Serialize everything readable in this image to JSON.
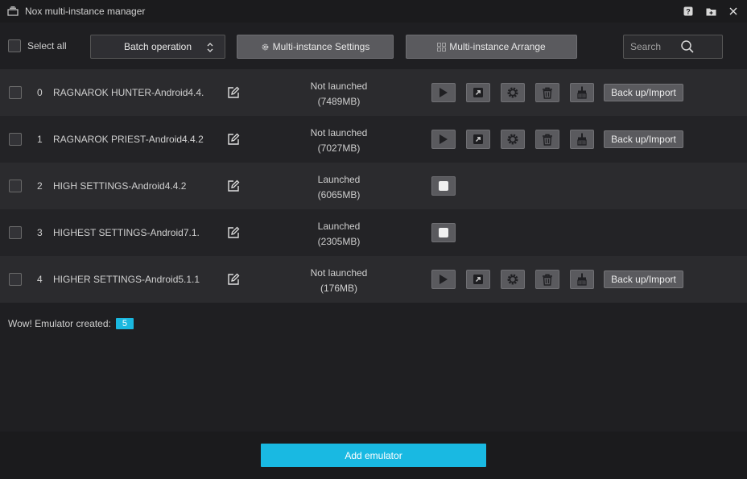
{
  "window": {
    "title": "Nox multi-instance manager"
  },
  "toolbar": {
    "select_all_label": "Select all",
    "batch_label": "Batch operation",
    "settings_label": "Multi-instance Settings",
    "arrange_label": "Multi-instance Arrange",
    "search_placeholder": "Search"
  },
  "instances": [
    {
      "index": "0",
      "name": "RAGNAROK HUNTER-Android4.4.",
      "status": "Not launched",
      "memory": "(7489MB)",
      "launched": false,
      "backup_label": "Back up/Import"
    },
    {
      "index": "1",
      "name": "RAGNAROK PRIEST-Android4.4.2",
      "status": "Not launched",
      "memory": "(7027MB)",
      "launched": false,
      "backup_label": "Back up/Import"
    },
    {
      "index": "2",
      "name": "HIGH SETTINGS-Android4.4.2",
      "status": "Launched",
      "memory": "(6065MB)",
      "launched": true
    },
    {
      "index": "3",
      "name": "HIGHEST SETTINGS-Android7.1.",
      "status": "Launched",
      "memory": "(2305MB)",
      "launched": true
    },
    {
      "index": "4",
      "name": "HIGHER SETTINGS-Android5.1.1",
      "status": "Not launched",
      "memory": "(176MB)",
      "launched": false,
      "backup_label": "Back up/Import"
    }
  ],
  "info": {
    "created_label": "Wow! Emulator created:",
    "created_count": "5"
  },
  "footer": {
    "add_label": "Add emulator"
  },
  "colors": {
    "accent": "#19b9e2",
    "background": "#1f1f22",
    "button": "#5a5a5e"
  }
}
